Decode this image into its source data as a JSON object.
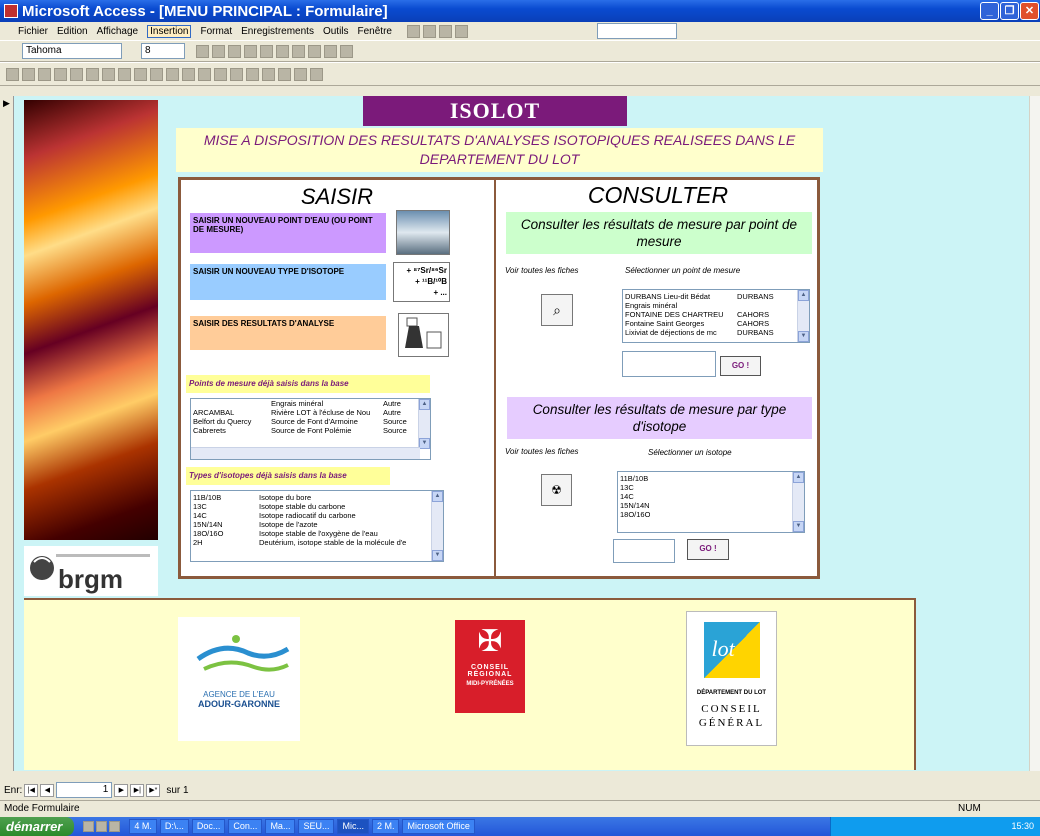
{
  "window": {
    "title": "Microsoft Access - [MENU PRINCIPAL : Formulaire]"
  },
  "menu": [
    "Fichier",
    "Edition",
    "Affichage",
    "Insertion",
    "Format",
    "Enregistrements",
    "Outils",
    "Fenêtre"
  ],
  "toolbar": {
    "font_name": "Tahoma",
    "font_size": "8"
  },
  "form": {
    "app_title": "ISOLOT",
    "headline": "MISE A DISPOSITION DES RESULTATS D'ANALYSES ISOTOPIQUES REALISEES DANS LE DEPARTEMENT DU LOT",
    "saisir": {
      "title": "SAISIR",
      "point_label": "SAISIR UN NOUVEAU POINT D'EAU (OU POINT DE MESURE)",
      "isotope_label": "SAISIR UN NOUVEAU TYPE D'ISOTOPE",
      "isotope_icon_line1": "+ ⁸⁷Sr/⁸⁶Sr",
      "isotope_icon_line2": "+ ¹¹B/¹⁰B",
      "isotope_icon_line3": "+ ...",
      "resultats_label": "SAISIR DES RESULTATS D'ANALYSE",
      "points_header": "Points de mesure déjà saisis dans la base",
      "points_rows": [
        [
          "",
          "Engrais minéral",
          "Autre"
        ],
        [
          "ARCAMBAL",
          "Rivière LOT à l'écluse de Nou",
          "Autre"
        ],
        [
          "Belfort du Quercy",
          "Source de Font d'Armoine",
          "Source"
        ],
        [
          "Cabrerets",
          "Source de Font Polémie",
          "Source"
        ]
      ],
      "types_header": "Types d'isotopes déjà saisis dans la base",
      "types_rows": [
        [
          "11B/10B",
          "Isotope du bore"
        ],
        [
          "13C",
          "Isotope stable du carbone"
        ],
        [
          "14C",
          "Isotope radiocatif du carbone"
        ],
        [
          "15N/14N",
          "Isotope de l'azote"
        ],
        [
          "18O/16O",
          "Isotope stable de l'oxygène de l'eau"
        ],
        [
          "2H",
          "Deutérium, isotope stable de la molécule d'e"
        ]
      ]
    },
    "consulter": {
      "title": "CONSULTER",
      "par_point_header": "Consulter les résultats de mesure par point de mesure",
      "voir_fiches_1": "Voir toutes les fiches",
      "select_point": "Sélectionner un point de mesure",
      "point_rows": [
        [
          "DURBANS Lieu-dit Bédat",
          "DURBANS"
        ],
        [
          "Engrais minéral",
          ""
        ],
        [
          "FONTAINE DES CHARTREU",
          "CAHORS"
        ],
        [
          "Fontaine Saint Georges",
          "CAHORS"
        ],
        [
          "Lixiviat de déjections de mc",
          "DURBANS"
        ]
      ],
      "go_1": "GO !",
      "par_type_header": "Consulter les résultats de mesure par type d'isotope",
      "voir_fiches_2": "Voir toutes les fiches",
      "select_isotope": "Sélectionner un isotope",
      "isotope_rows": [
        "11B/10B",
        "13C",
        "14C",
        "15N/14N",
        "18O/16O"
      ],
      "go_2": "GO !"
    }
  },
  "logos": {
    "brgm": "brgm",
    "adour_line1": "AGENCE DE L'EAU",
    "adour_line2": "ADOUR-GARONNE",
    "region_lines": "CONSEIL RÉGIONAL",
    "region_sub": "MIDI-PYRÉNÉES",
    "lot_dept": "DÉPARTEMENT DU LOT",
    "lot_conseil": "CONSEIL GÉNÉRAL"
  },
  "nav": {
    "label": "Enr:",
    "record": "1",
    "of_total": "sur 1"
  },
  "status": {
    "mode": "Mode Formulaire",
    "num": "NUM"
  },
  "taskbar": {
    "start": "démarrer",
    "tasks": [
      "4 M.",
      "D:\\...",
      "Doc...",
      "Con...",
      "Ma...",
      "SEU...",
      "Mic...",
      "2 M.",
      "Microsoft Office"
    ],
    "clock": "15:30"
  },
  "colors": {
    "form_bg": "#ccf4f6",
    "purple": "#7b1a7a",
    "brown_border": "#8b5a3c"
  }
}
